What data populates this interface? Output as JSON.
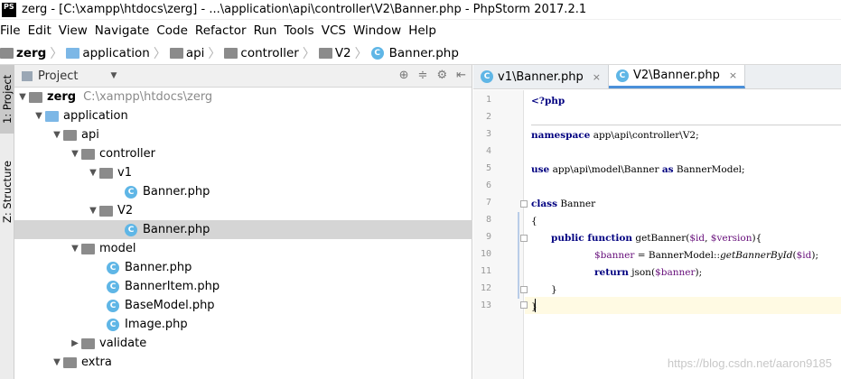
{
  "title": {
    "logo": "PS",
    "text": "zerg - [C:\\xampp\\htdocs\\zerg] - ...\\application\\api\\controller\\V2\\Banner.php - PhpStorm 2017.2.1"
  },
  "menu": [
    "File",
    "Edit",
    "View",
    "Navigate",
    "Code",
    "Refactor",
    "Run",
    "Tools",
    "VCS",
    "Window",
    "Help"
  ],
  "breadcrumb": [
    "zerg",
    "application",
    "api",
    "controller",
    "V2",
    "Banner.php"
  ],
  "side_tabs": {
    "project": "1: Project",
    "structure": "Z: Structure"
  },
  "project_panel": {
    "title": "Project",
    "tree": [
      {
        "label": "zerg",
        "hint": "C:\\xampp\\htdocs\\zerg",
        "arrow": "▼"
      },
      {
        "label": "application",
        "arrow": "▼"
      },
      {
        "label": "api",
        "arrow": "▼"
      },
      {
        "label": "controller",
        "arrow": "▼"
      },
      {
        "label": "v1",
        "arrow": "▼"
      },
      {
        "label": "Banner.php",
        "icon": "C"
      },
      {
        "label": "V2",
        "arrow": "▼"
      },
      {
        "label": "Banner.php",
        "icon": "C"
      },
      {
        "label": "model",
        "arrow": "▼"
      },
      {
        "label": "Banner.php",
        "icon": "C"
      },
      {
        "label": "BannerItem.php",
        "icon": "C"
      },
      {
        "label": "BaseModel.php",
        "icon": "C"
      },
      {
        "label": "Image.php",
        "icon": "C"
      },
      {
        "label": "validate",
        "arrow": "▶"
      },
      {
        "label": "extra",
        "arrow": "▼"
      }
    ]
  },
  "editor": {
    "tabs": [
      {
        "label": "v1\\Banner.php",
        "close": "×"
      },
      {
        "label": "V2\\Banner.php",
        "close": "×"
      }
    ],
    "line_numbers": [
      "1",
      "2",
      "3",
      "4",
      "5",
      "6",
      "7",
      "8",
      "9",
      "10",
      "11",
      "12",
      "13"
    ],
    "code": {
      "l1": "<?php",
      "l3_kw": "namespace",
      "l3_rest": " app\\api\\controller\\V2;",
      "l5_kw": "use",
      "l5_mid": " app\\api\\model\\Banner ",
      "l5_as": "as",
      "l5_end": " BannerModel;",
      "l7_kw": "class",
      "l7_rest": " Banner",
      "l8": "{",
      "l9_kw1": "public",
      "l9_kw2": " function",
      "l9_name": " getBanner(",
      "l9_v1": "$id",
      "l9_comma": ", ",
      "l9_v2": "$version",
      "l9_end": "){",
      "l10_v": "$banner",
      "l10_mid": " = BannerModel::",
      "l10_call": "getBannerById",
      "l10_open": "(",
      "l10_v2": "$id",
      "l10_end": ");",
      "l11_kw": "return",
      "l11_mid": " json(",
      "l11_v": "$banner",
      "l11_end": ");",
      "l12": "}",
      "l13": "}"
    }
  },
  "watermark": "https://blog.csdn.net/aaron9185"
}
